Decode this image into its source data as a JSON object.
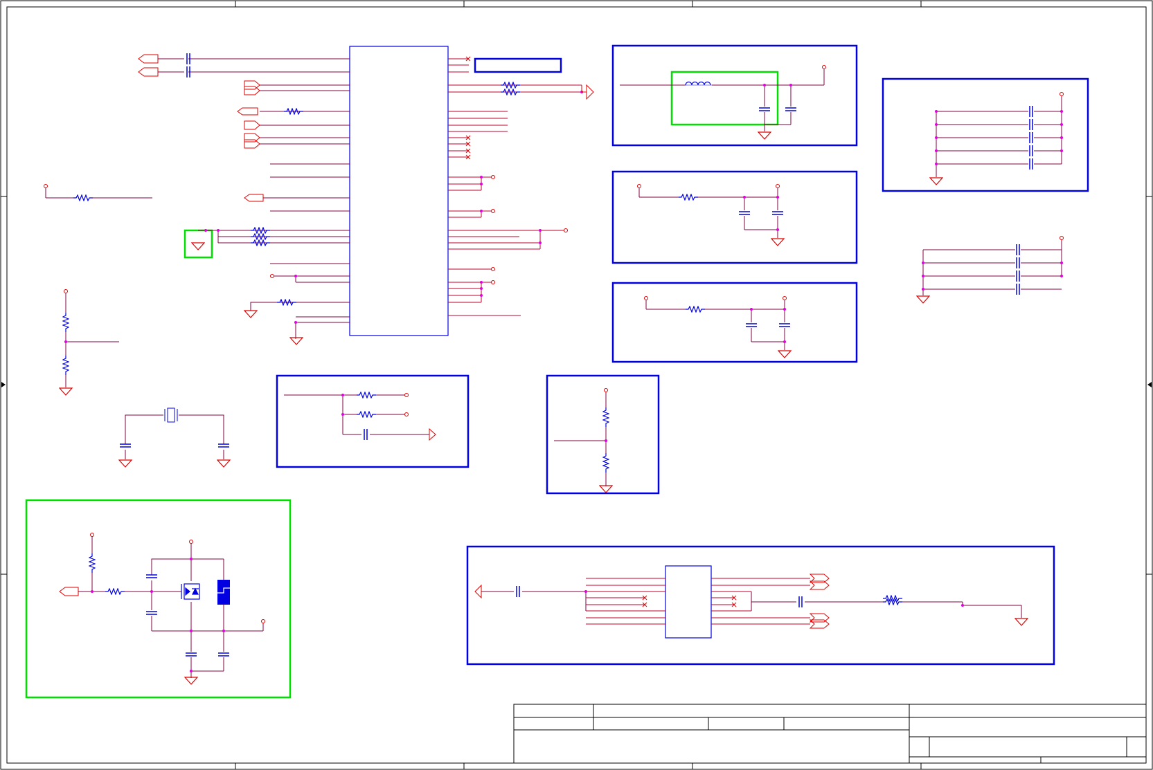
{
  "sheet": {
    "background": "#ffffff",
    "frame_color": "#000000"
  },
  "colors": {
    "wire": "#c0002a",
    "net": "#800040",
    "component": "#0000e0",
    "highlight": "#00e000",
    "junction": "#e000e0",
    "port": "#e00000",
    "ic_fill": "#ffffff"
  },
  "blocks": [
    {
      "name": "main-ic",
      "kind": "integrated-circuit"
    },
    {
      "name": "connector-label-box",
      "kind": "label-box"
    },
    {
      "name": "ferrite-filter-block",
      "kind": "blue-box"
    },
    {
      "name": "rc-filter-block-1",
      "kind": "blue-box"
    },
    {
      "name": "rc-filter-block-2",
      "kind": "blue-box"
    },
    {
      "name": "decoupling-cap-block",
      "kind": "blue-box"
    },
    {
      "name": "resistor-pulldown-block",
      "kind": "blue-box"
    },
    {
      "name": "voltage-divider-block",
      "kind": "blue-box"
    },
    {
      "name": "transistor-switch-block",
      "kind": "green-box"
    },
    {
      "name": "connector-interface-block",
      "kind": "blue-box"
    },
    {
      "name": "title-block",
      "kind": "frame"
    }
  ]
}
